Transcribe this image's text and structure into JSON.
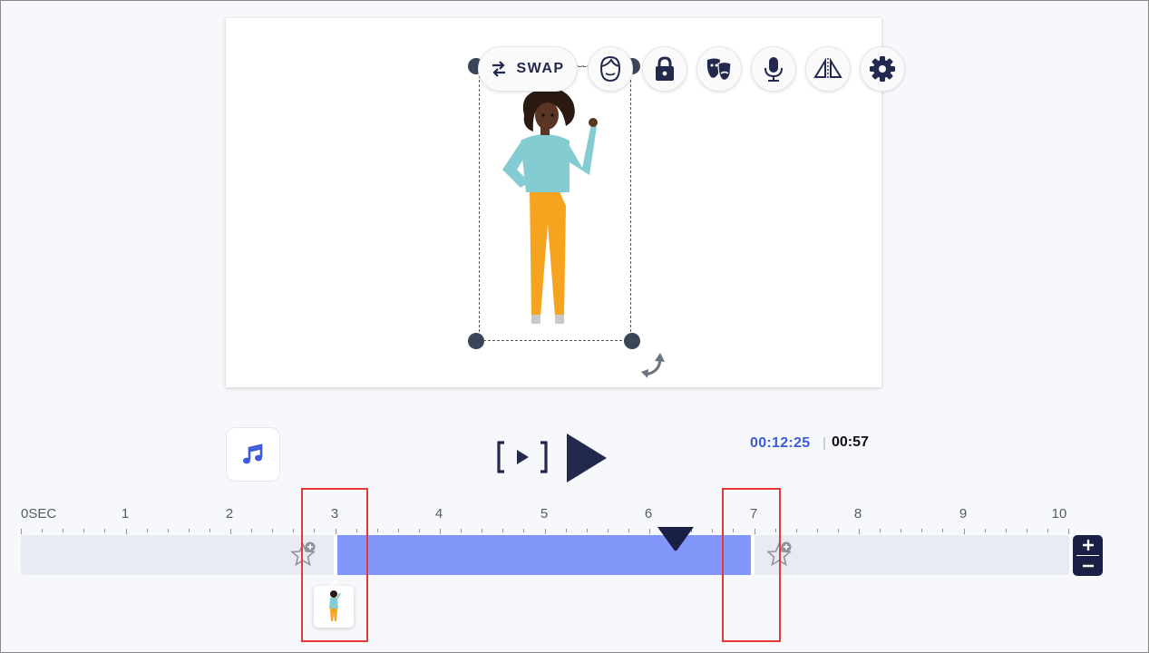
{
  "toolbar": {
    "swap_label": "SWAP",
    "buttons": [
      "face-icon",
      "lock-icon",
      "theater-masks-icon",
      "microphone-icon",
      "flip-icon",
      "gear-icon"
    ]
  },
  "playback": {
    "current_time": "00:12:25",
    "total_time": "00:57"
  },
  "timeline": {
    "labels": [
      "0SEC",
      "1",
      "2",
      "3",
      "4",
      "5",
      "6",
      "7",
      "8",
      "9",
      "10"
    ],
    "clip_start_sec": 3.0,
    "clip_end_sec": 7.0,
    "playhead_sec": 6.25
  },
  "colors": {
    "accent": "#8397fb",
    "navy": "#1a1f45",
    "highlight": "#e53935",
    "time_blue": "#3b5bdb"
  }
}
